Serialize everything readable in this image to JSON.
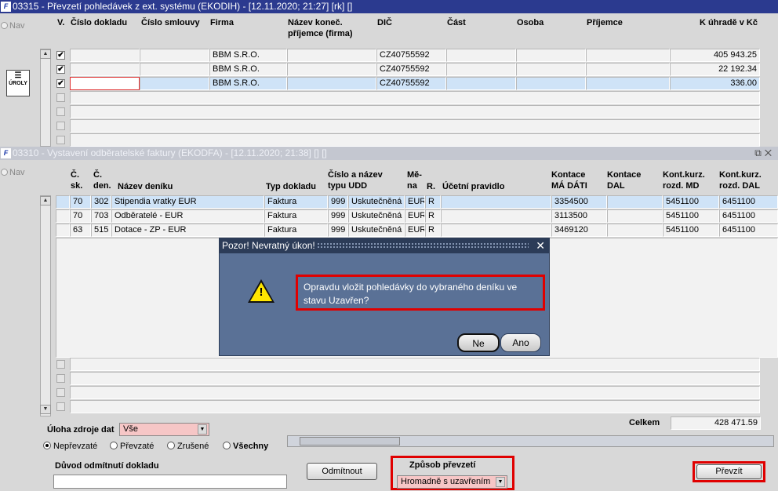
{
  "win1": {
    "title": "03315 - Převzetí pohledávek z ext. systému (EKODIH) - [12.11.2020; 21:27]  [rk]  []",
    "nav": "Nav",
    "tool_label": "ÚROLY",
    "headers": [
      "V.",
      "Číslo dokladu",
      "Číslo smlouvy",
      "Firma",
      "Název koneč. příjemce (firma)",
      "DIČ",
      "Část",
      "Osoba",
      "Příjemce",
      "K úhradě v Kč"
    ],
    "rows": [
      {
        "checked": "✔",
        "firma": "BBM S.R.O.",
        "dic": "CZ40755592",
        "amount": "405 943.25"
      },
      {
        "checked": "✔",
        "firma": "BBM S.R.O.",
        "dic": "CZ40755592",
        "amount": "22 192.34"
      },
      {
        "checked": "✔",
        "firma": "BBM S.R.O.",
        "dic": "CZ40755592",
        "amount": "336.00"
      }
    ]
  },
  "win2": {
    "title": "03310 - Vystavení odběratelské faktury (EKODFA) - [12.11.2020; 21:38]  []  []",
    "nav": "Nav",
    "headers": {
      "sk": "Č. sk.",
      "den": "Č. den.",
      "nazev": "Název deníku",
      "typ": "Typ dokladu",
      "udd": "Číslo a název typu UDD",
      "mena": "Mě- na",
      "r": "R.",
      "pravidlo": "Účetní pravidlo",
      "md": "Kontace MÁ DÁTI",
      "dal": "Kontace DAL",
      "kurz_md": "Kont.kurz. rozd. MD",
      "kurz_dal": "Kont.kurz. rozd. DAL"
    },
    "rows": [
      {
        "sk": "70",
        "den": "302",
        "nazev": "Stipendia vratky EUR",
        "typ": "Faktura",
        "udd_no": "999",
        "udd_name": "Uskutečněná",
        "mena": "EUR",
        "r": "R",
        "md": "3354500",
        "kurz_md": "5451100",
        "kurz_dal": "6451100"
      },
      {
        "sk": "70",
        "den": "703",
        "nazev": "Odběratelé - EUR",
        "typ": "Faktura",
        "udd_no": "999",
        "udd_name": "Uskutečněná",
        "mena": "EUR",
        "r": "R",
        "md": "3113500",
        "kurz_md": "5451100",
        "kurz_dal": "6451100"
      },
      {
        "sk": "63",
        "den": "515",
        "nazev": "Dotace - ZP - EUR",
        "typ": "Faktura",
        "udd_no": "999",
        "udd_name": "Uskutečněná",
        "mena": "EUR",
        "r": "R",
        "md": "3469120",
        "kurz_md": "5451100",
        "kurz_dal": "6451100"
      }
    ]
  },
  "dialog": {
    "title": "Pozor! Nevratný úkon!",
    "message": "Opravdu vložit pohledávky do vybraného deníku ve stavu Uzavřen?",
    "btn_no": "Ne",
    "btn_yes": "Ano"
  },
  "bottom": {
    "uloha_label": "Úloha zdroje dat",
    "uloha_value": "Vše",
    "radios": [
      "Nepřevzaté",
      "Převzaté",
      "Zrušené",
      "Všechny"
    ],
    "radio_selected": "Nepřevzaté",
    "celkem_label": "Celkem",
    "celkem_value": "428 471.59",
    "duvod_label": "Důvod odmítnutí dokladu",
    "odmitnout": "Odmítnout",
    "zpusob_label": "Způsob převzetí",
    "zpusob_value": "Hromadně s uzavřením",
    "prevzit": "Převzít"
  },
  "colors": {
    "title_active": "#2b3a8f",
    "dialog_bg": "#5a7196",
    "highlight": "#e00000",
    "selected_row": "#cfe3f7"
  }
}
